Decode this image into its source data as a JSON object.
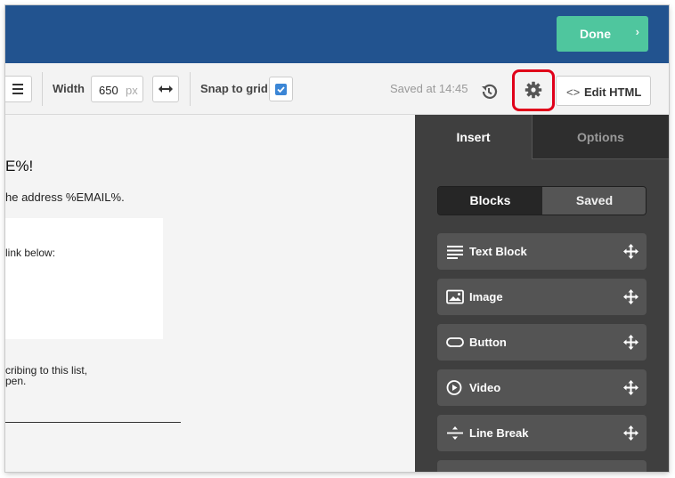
{
  "header": {
    "done_label": "Done",
    "done_chevron": "›",
    "accent_color": "#22538f",
    "done_color": "#4fc69e"
  },
  "toolbar": {
    "width_label": "Width",
    "width_value": "650",
    "width_unit": "px",
    "snap_label": "Snap to grid",
    "snap_checked": true,
    "saved_text": "Saved at 14:45",
    "edit_html_code_glyph": "<>",
    "edit_html_label": "Edit HTML",
    "icons": [
      "align-center-icon",
      "expand-horizontal-icon",
      "history-icon",
      "gear-icon",
      "code-icon"
    ]
  },
  "canvas": {
    "heading": "E%!",
    "address_line": "he address %EMAIL%.",
    "link_line": "link below:",
    "subscribe_line1": "cribing to this list,",
    "subscribe_line2": "pen."
  },
  "panel": {
    "tabs": [
      {
        "label": "Insert",
        "active": true
      },
      {
        "label": "Options",
        "active": false
      }
    ],
    "segments": [
      {
        "label": "Blocks",
        "active": true
      },
      {
        "label": "Saved",
        "active": false
      }
    ],
    "blocks": [
      {
        "label": "Text Block",
        "icon": "text-lines-icon"
      },
      {
        "label": "Image",
        "icon": "image-icon"
      },
      {
        "label": "Button",
        "icon": "button-pill-icon"
      },
      {
        "label": "Video",
        "icon": "play-circle-icon"
      },
      {
        "label": "Line Break",
        "icon": "divider-icon"
      }
    ]
  }
}
